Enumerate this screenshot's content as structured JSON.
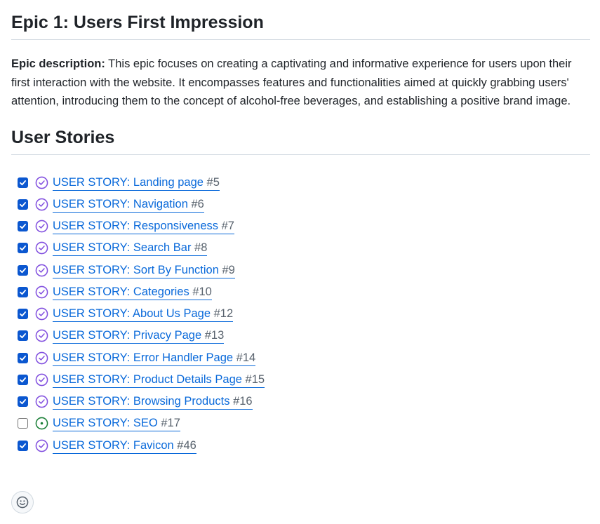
{
  "epic": {
    "title": "Epic 1: Users First Impression",
    "description_label": "Epic description:",
    "description_text": " This epic focuses on creating a captivating and informative experience for users upon their first interaction with the website. It encompasses features and functionalities aimed at quickly grabbing users' attention, introducing them to the concept of alcohol-free beverages, and establishing a positive brand image."
  },
  "stories_heading": "User Stories",
  "colors": {
    "link": "#0969da",
    "closed_icon": "#8250df",
    "open_icon": "#1a7f37",
    "checkbox_checked": "#0b57d0"
  },
  "stories": [
    {
      "title": "USER STORY: Landing page",
      "number": " #5",
      "checked": true,
      "state": "closed"
    },
    {
      "title": "USER STORY: Navigation",
      "number": " #6",
      "checked": true,
      "state": "closed"
    },
    {
      "title": "USER STORY: Responsiveness",
      "number": " #7",
      "checked": true,
      "state": "closed"
    },
    {
      "title": "USER STORY: Search Bar",
      "number": " #8",
      "checked": true,
      "state": "closed"
    },
    {
      "title": "USER STORY: Sort By Function",
      "number": " #9",
      "checked": true,
      "state": "closed"
    },
    {
      "title": "USER STORY: Categories",
      "number": " #10",
      "checked": true,
      "state": "closed"
    },
    {
      "title": "USER STORY: About Us Page",
      "number": " #12",
      "checked": true,
      "state": "closed"
    },
    {
      "title": "USER STORY: Privacy Page",
      "number": " #13",
      "checked": true,
      "state": "closed"
    },
    {
      "title": "USER STORY: Error Handler Page",
      "number": " #14",
      "checked": true,
      "state": "closed"
    },
    {
      "title": "USER STORY: Product Details Page",
      "number": " #15",
      "checked": true,
      "state": "closed"
    },
    {
      "title": "USER STORY: Browsing Products",
      "number": " #16",
      "checked": true,
      "state": "closed"
    },
    {
      "title": "USER STORY: SEO",
      "number": " #17",
      "checked": false,
      "state": "open"
    },
    {
      "title": "USER STORY: Favicon",
      "number": " #46",
      "checked": true,
      "state": "closed"
    }
  ],
  "reaction": {
    "icon": "smiley-icon"
  }
}
